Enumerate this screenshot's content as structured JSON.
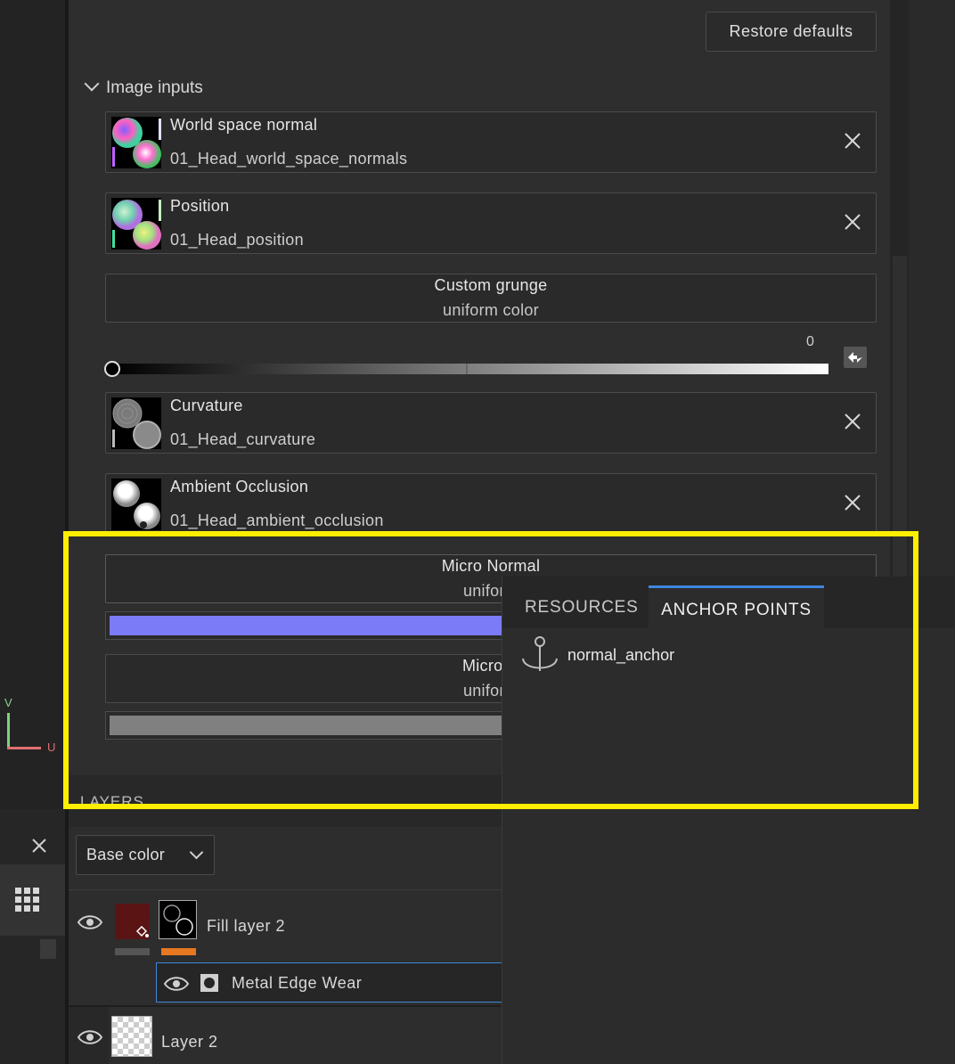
{
  "properties": {
    "restore_label": "Restore defaults",
    "section_title": "Image inputs",
    "inputs": [
      {
        "name": "World space normal",
        "file": "01_Head_world_space_normals"
      },
      {
        "name": "Position",
        "file": "01_Head_position"
      },
      {
        "name": "Curvature",
        "file": "01_Head_curvature"
      },
      {
        "name": "Ambient Occlusion",
        "file": "01_Head_ambient_occlusion"
      }
    ],
    "custom_grunge": {
      "title": "Custom grunge",
      "value": "uniform color"
    },
    "slider_value": "0",
    "micro_normal": {
      "title": "Micro Normal",
      "value": "uniform",
      "color": "#7b7bf7"
    },
    "micro_height": {
      "title": "Micro H",
      "value": "uniform",
      "color": "#808080"
    }
  },
  "popup": {
    "tabs": [
      "RESOURCES",
      "ANCHOR POINTS"
    ],
    "active_tab": "ANCHOR POINTS",
    "items": [
      {
        "label": "normal_anchor",
        "icon": "anchor-icon"
      }
    ]
  },
  "layers": {
    "title": "LAYERS",
    "channel": "Base color",
    "rows": [
      {
        "name": "Fill layer 2",
        "color_swatch": "#5a1414",
        "tag_color": "#e87722"
      },
      {
        "name": "Metal Edge Wear"
      },
      {
        "name": "Layer 2"
      }
    ]
  },
  "viewport": {
    "axis_v": "V",
    "axis_u": "U"
  },
  "colors": {
    "accent": "#3f86e0",
    "highlight": "#ffee00"
  }
}
